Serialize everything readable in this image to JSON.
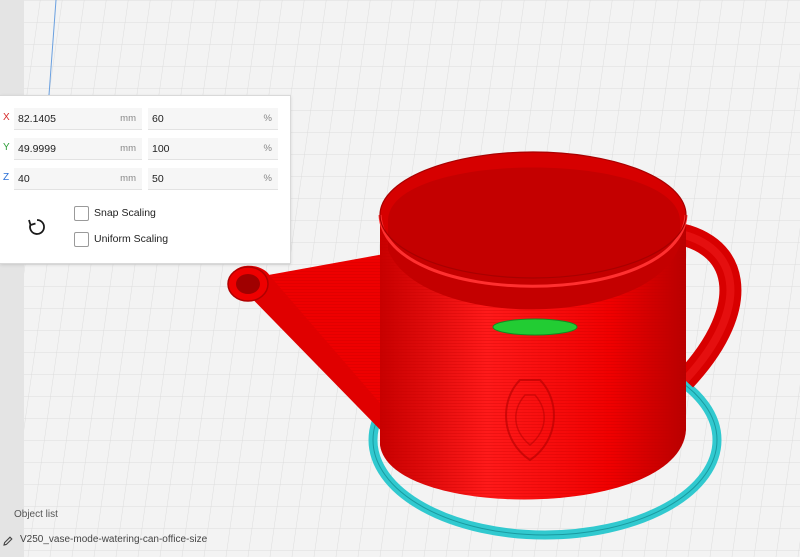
{
  "scale_panel": {
    "rows": [
      {
        "axis": "X",
        "axis_color": "#d62a2a",
        "value_mm": "82.1405",
        "unit_mm": "mm",
        "value_pct": "60",
        "unit_pct": "%"
      },
      {
        "axis": "Y",
        "axis_color": "#2e9e3a",
        "value_mm": "49.9999",
        "unit_mm": "mm",
        "value_pct": "100",
        "unit_pct": "%"
      },
      {
        "axis": "Z",
        "axis_color": "#2a6fd6",
        "value_mm": "40",
        "unit_mm": "mm",
        "value_pct": "50",
        "unit_pct": "%"
      }
    ],
    "snap_scaling": {
      "label": "Snap Scaling",
      "checked": false
    },
    "uniform_scaling": {
      "label": "Uniform Scaling",
      "checked": false
    },
    "reset_icon": "reset-rotate-icon"
  },
  "object_list": {
    "label": "Object list",
    "object_name": "V250_vase-mode-watering-can-office-size",
    "edit_icon": "pencil-icon"
  },
  "colors": {
    "model": "#ee0000",
    "model_top": "#22cc33",
    "brim": "#31c9cf",
    "build_plate": "#f3f3f3",
    "grid": "#d8d8d8"
  }
}
